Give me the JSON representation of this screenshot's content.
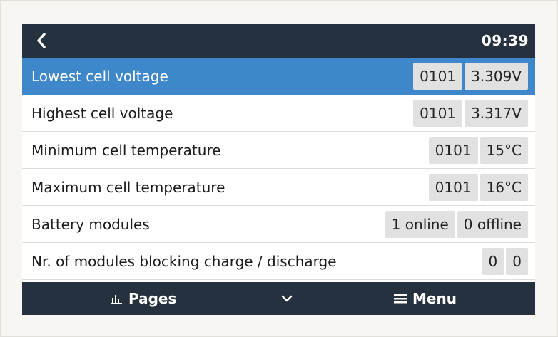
{
  "header": {
    "time": "09:39"
  },
  "rows": [
    {
      "label": "Lowest cell voltage",
      "values": [
        "0101",
        "3.309V"
      ]
    },
    {
      "label": "Highest cell voltage",
      "values": [
        "0101",
        "3.317V"
      ]
    },
    {
      "label": "Minimum cell temperature",
      "values": [
        "0101",
        "15°C"
      ]
    },
    {
      "label": "Maximum cell temperature",
      "values": [
        "0101",
        "16°C"
      ]
    },
    {
      "label": "Battery modules",
      "values": [
        "1 online",
        "0 offline"
      ]
    },
    {
      "label": "Nr. of modules blocking charge / discharge",
      "values": [
        "0",
        "0"
      ]
    }
  ],
  "footer": {
    "pages_label": "Pages",
    "menu_label": "Menu"
  },
  "icons": {
    "back": "chevron-left-icon",
    "pages": "bar-chart-icon",
    "chevron": "chevron-down-icon",
    "menu": "hamburger-menu-icon"
  },
  "colors": {
    "bar": "#25313e",
    "selected": "#3f87cb",
    "value_box": "#e1e1e1"
  }
}
